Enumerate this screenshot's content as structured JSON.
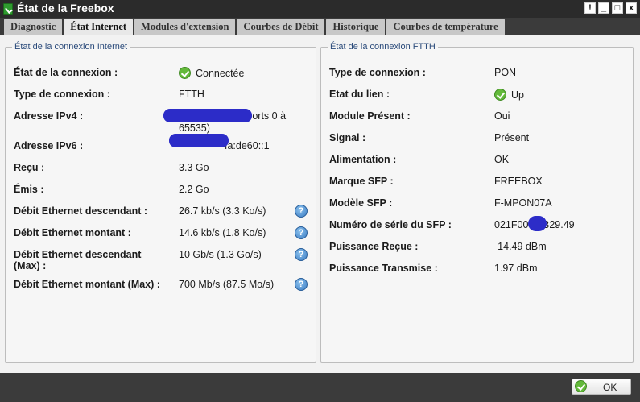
{
  "window": {
    "title": "État de la Freebox",
    "controls": [
      "!",
      "_",
      "□",
      "x"
    ]
  },
  "tabs": [
    {
      "label": "Diagnostic",
      "active": false
    },
    {
      "label": "État Internet",
      "active": true
    },
    {
      "label": "Modules d'extension",
      "active": false
    },
    {
      "label": "Courbes de Débit",
      "active": false
    },
    {
      "label": "Historique",
      "active": false
    },
    {
      "label": "Courbes de température",
      "active": false
    }
  ],
  "internet": {
    "legend": "État de la connexion Internet",
    "rows": [
      {
        "label": "État de la connexion :",
        "value": "Connectée",
        "icon": "ok-icon"
      },
      {
        "label": "Type de connexion :",
        "value": "FTTH"
      },
      {
        "label": "Adresse IPv4 :",
        "value_line1": "Ports 0 à",
        "value_line2": "65535)"
      },
      {
        "label": "Adresse IPv6 :",
        "value": "fa:de60::1"
      },
      {
        "label": "Reçu :",
        "value": "3.3 Go"
      },
      {
        "label": "Émis :",
        "value": "2.2 Go"
      },
      {
        "label": "Débit Ethernet descendant :",
        "value": "26.7 kb/s (3.3 Ko/s)",
        "help": true
      },
      {
        "label": "Débit Ethernet montant :",
        "value": "14.6 kb/s (1.8 Ko/s)",
        "help": true
      },
      {
        "label_line1": "Débit Ethernet descendant",
        "label_line2": "(Max) :",
        "value": "10 Gb/s (1.3 Go/s)",
        "help": true
      },
      {
        "label": "Débit Ethernet montant (Max) :",
        "value": "700 Mb/s (87.5 Mo/s)",
        "help": true
      }
    ]
  },
  "ftth": {
    "legend": "État de la connexion FTTH",
    "rows": [
      {
        "label": "Type de connexion :",
        "value": "PON"
      },
      {
        "label": "Etat du lien :",
        "value": "Up",
        "icon": "ok-icon"
      },
      {
        "label": "Module Présent :",
        "value": "Oui"
      },
      {
        "label": "Signal :",
        "value": "Présent"
      },
      {
        "label": "Alimentation :",
        "value": "OK"
      },
      {
        "label": "Marque SFP :",
        "value": "FREEBOX"
      },
      {
        "label": "Modèle SFP :",
        "value": "F-MPON07A"
      },
      {
        "label": "Numéro de série du SFP :",
        "value": "021F005",
        "value_suffix": "B29.49"
      },
      {
        "label": "Puissance Reçue :",
        "value": "-14.49 dBm"
      },
      {
        "label": "Puissance Transmise :",
        "value": "1.97 dBm"
      }
    ]
  },
  "help_glyph": "?",
  "footer": {
    "ok_label": "OK"
  },
  "colors": {
    "accent_green": "#63b93a",
    "redaction": "#2c2cc8",
    "help_blue": "#3a7cc4"
  }
}
